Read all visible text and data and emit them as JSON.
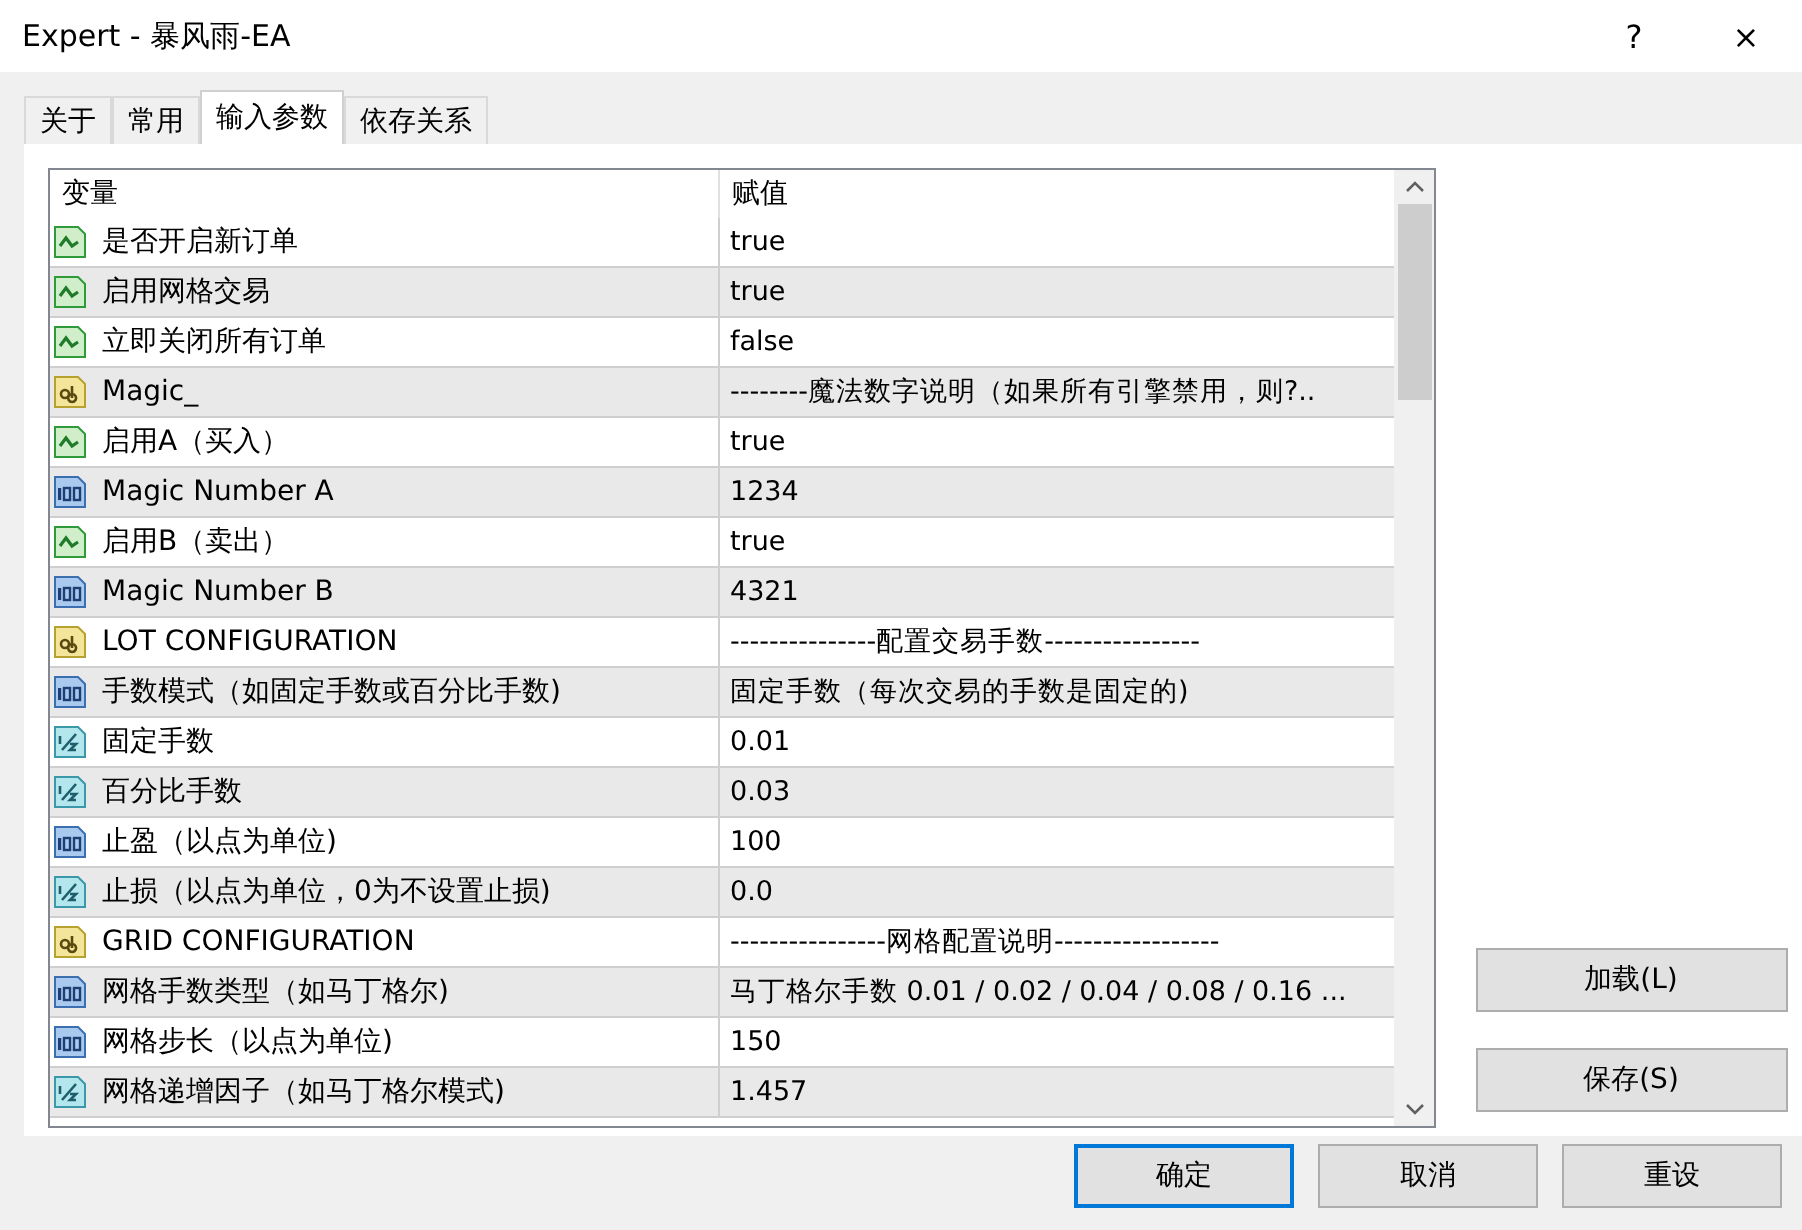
{
  "window": {
    "title": "Expert - 暴风雨-EA",
    "help": "?",
    "close": "×"
  },
  "tabs": [
    {
      "label": "关于",
      "selected": false
    },
    {
      "label": "常用",
      "selected": false
    },
    {
      "label": "输入参数",
      "selected": true
    },
    {
      "label": "依存关系",
      "selected": false
    }
  ],
  "table": {
    "columns": [
      "变量",
      "赋值"
    ],
    "rows": [
      {
        "kind": "bool",
        "name": "是否开启新订单",
        "value": "true"
      },
      {
        "kind": "bool",
        "name": "启用网格交易",
        "value": "true"
      },
      {
        "kind": "bool",
        "name": "立即关闭所有订单",
        "value": "false"
      },
      {
        "kind": "string",
        "name": "Magic_",
        "value": "--------魔法数字说明（如果所有引擎禁用，则?.."
      },
      {
        "kind": "bool",
        "name": "启用A（买入）",
        "value": "true"
      },
      {
        "kind": "int",
        "name": "Magic Number  A",
        "value": "1234"
      },
      {
        "kind": "bool",
        "name": "启用B（卖出）",
        "value": "true"
      },
      {
        "kind": "int",
        "name": "Magic Number  B",
        "value": "4321"
      },
      {
        "kind": "string",
        "name": "LOT CONFIGURATION",
        "value": "---------------配置交易手数----------------"
      },
      {
        "kind": "int",
        "name": "手数模式（如固定手数或百分比手数)",
        "value": "固定手数（每次交易的手数是固定的)"
      },
      {
        "kind": "double",
        "name": "固定手数",
        "value": "0.01"
      },
      {
        "kind": "double",
        "name": "百分比手数",
        "value": "0.03"
      },
      {
        "kind": "int",
        "name": "止盈（以点为单位)",
        "value": "100"
      },
      {
        "kind": "double",
        "name": "止损（以点为单位，0为不设置止损)",
        "value": "0.0"
      },
      {
        "kind": "string",
        "name": "GRID CONFIGURATION",
        "value": "----------------网格配置说明-----------------"
      },
      {
        "kind": "int",
        "name": "网格手数类型（如马丁格尔)",
        "value": "马丁格尔手数  0.01 / 0.02 / 0.04 / 0.08 / 0.16 ..."
      },
      {
        "kind": "int",
        "name": "网格步长（以点为单位)",
        "value": "150"
      },
      {
        "kind": "double",
        "name": "网格递增因子（如马丁格尔模式)",
        "value": "1.457"
      }
    ]
  },
  "side_buttons": [
    "加载(L)",
    "保存(S)"
  ],
  "footer_buttons": [
    {
      "label": "确定",
      "default": true
    },
    {
      "label": "取消",
      "default": false
    },
    {
      "label": "重设",
      "default": false
    }
  ]
}
